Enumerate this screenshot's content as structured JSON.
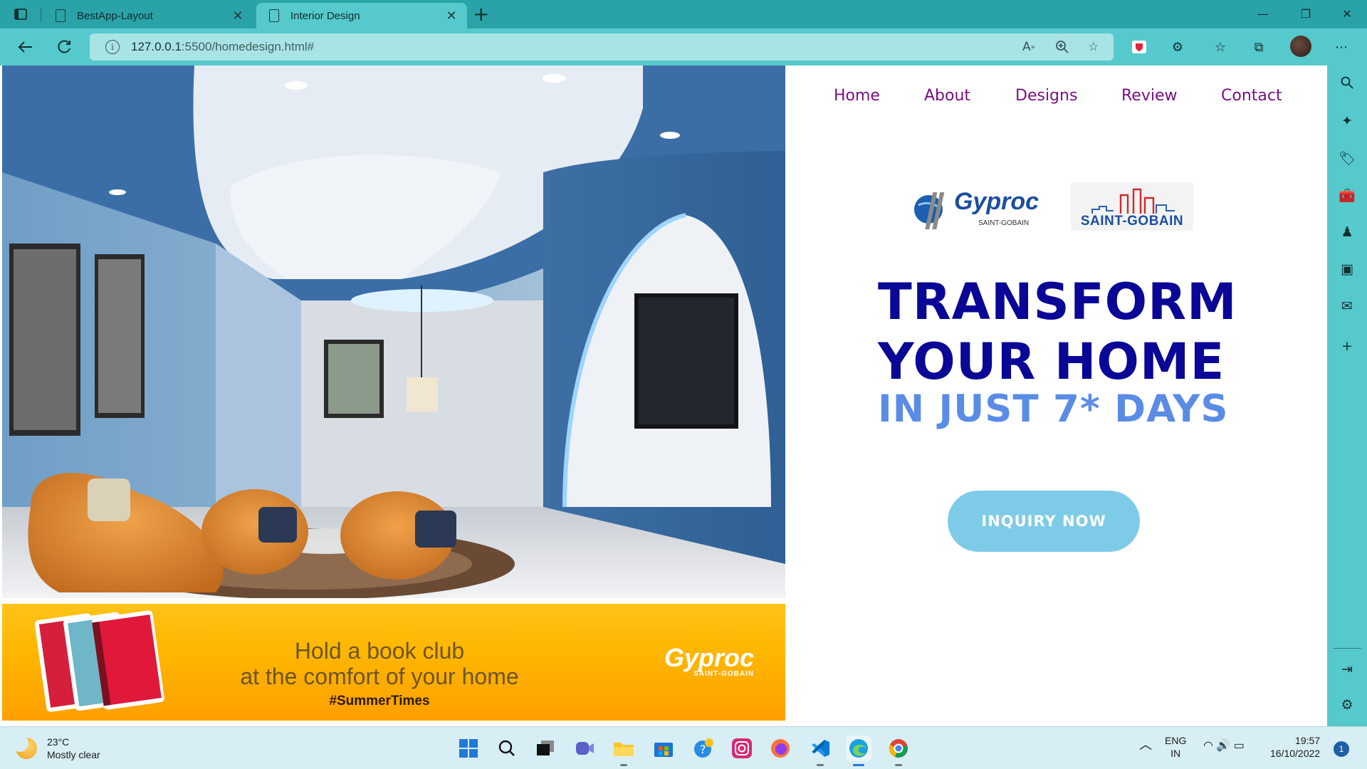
{
  "browser": {
    "tabs": [
      {
        "label": "BestApp-Layout",
        "active": false
      },
      {
        "label": "Interior Design",
        "active": true
      }
    ],
    "url": {
      "host": "127.0.0.1",
      "rest": ":5500/homedesign.html#"
    },
    "accent": "#56c9cd"
  },
  "site": {
    "nav": [
      "Home",
      "About",
      "Designs",
      "Review",
      "Contact"
    ],
    "logos": {
      "gyproc": {
        "name": "Gyproc",
        "sub": "SAINT-GOBAIN"
      },
      "saint_gobain": {
        "name": "SAINT-GOBAIN"
      }
    },
    "headline": {
      "line1": "TRANSFORM",
      "line2": "YOUR HOME",
      "line3": "IN JUST 7* DAYS"
    },
    "cta": "INQUIRY NOW",
    "banner": {
      "line1": "Hold a book club",
      "line2": "at the comfort of your home",
      "hashtag": "#SummerTimes",
      "brand": "Gyproc",
      "brand_sub": "SAINT-GOBAIN"
    },
    "colors": {
      "nav": "#7a0f86",
      "headline": "#0a0796",
      "subheadline": "#5a8ce6",
      "cta": "#7ecbe8"
    }
  },
  "taskbar": {
    "weather": {
      "temp": "23°C",
      "desc": "Mostly clear"
    },
    "lang": {
      "line1": "ENG",
      "line2": "IN"
    },
    "clock": {
      "time": "19:57",
      "date": "16/10/2022"
    },
    "notifications": "1",
    "apps": [
      "start-icon",
      "search-icon",
      "task-view-icon",
      "teams-icon",
      "file-explorer-icon",
      "store-icon",
      "help-icon",
      "instagram-icon",
      "firefox-icon",
      "vscode-icon",
      "edge-icon",
      "chrome-icon"
    ]
  }
}
